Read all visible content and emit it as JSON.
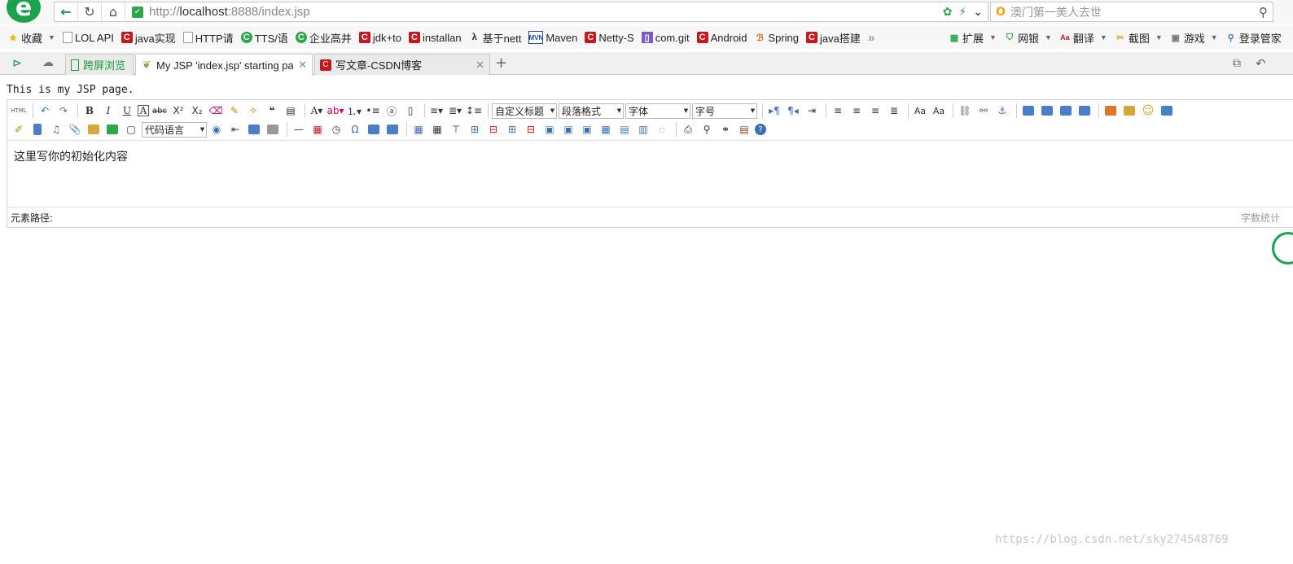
{
  "browser": {
    "logo_glyph": "e",
    "address": {
      "url_prefix": "http://",
      "url_host": "localhost",
      "url_rest": ":8888/index.jsp"
    },
    "search": {
      "engine_glyph": "O",
      "text": "澳门第一美人去世"
    },
    "bookmarks": [
      {
        "icon": "star",
        "label": "收藏"
      },
      {
        "icon": "page",
        "label": "LOL API"
      },
      {
        "icon": "c",
        "label": "java实现"
      },
      {
        "icon": "page",
        "label": "HTTP请"
      },
      {
        "icon": "g",
        "label": "TTS/语"
      },
      {
        "icon": "g",
        "label": "企业高并"
      },
      {
        "icon": "c",
        "label": "jdk+to"
      },
      {
        "icon": "c",
        "label": "installan"
      },
      {
        "icon": "lambda",
        "label": "基于nett"
      },
      {
        "icon": "mvn",
        "label": "Maven"
      },
      {
        "icon": "c",
        "label": "Netty-S"
      },
      {
        "icon": "doc",
        "label": "com.git"
      },
      {
        "icon": "c",
        "label": "Android"
      },
      {
        "icon": "spring",
        "label": "Spring"
      },
      {
        "icon": "c",
        "label": "java搭建"
      }
    ],
    "more_glyph": "»",
    "toolbar_right": [
      "扩展",
      "网银",
      "翻译",
      "截图",
      "游戏",
      "登录管家"
    ],
    "tabs": [
      {
        "label": "跨屏浏览"
      },
      {
        "label": "My JSP 'index.jsp' starting pa"
      },
      {
        "label": "写文章-CSDN博客"
      }
    ]
  },
  "page": {
    "heading": "This is my JSP page.",
    "editor": {
      "dropdowns": [
        "自定义标题",
        "段落格式",
        "字体",
        "字号"
      ],
      "code_lang": "代码语言",
      "content": "这里写你的初始化内容",
      "path_label": "元素路径:",
      "count_label": "字数统计"
    }
  },
  "watermark": "https://blog.csdn.net/sky274548769"
}
